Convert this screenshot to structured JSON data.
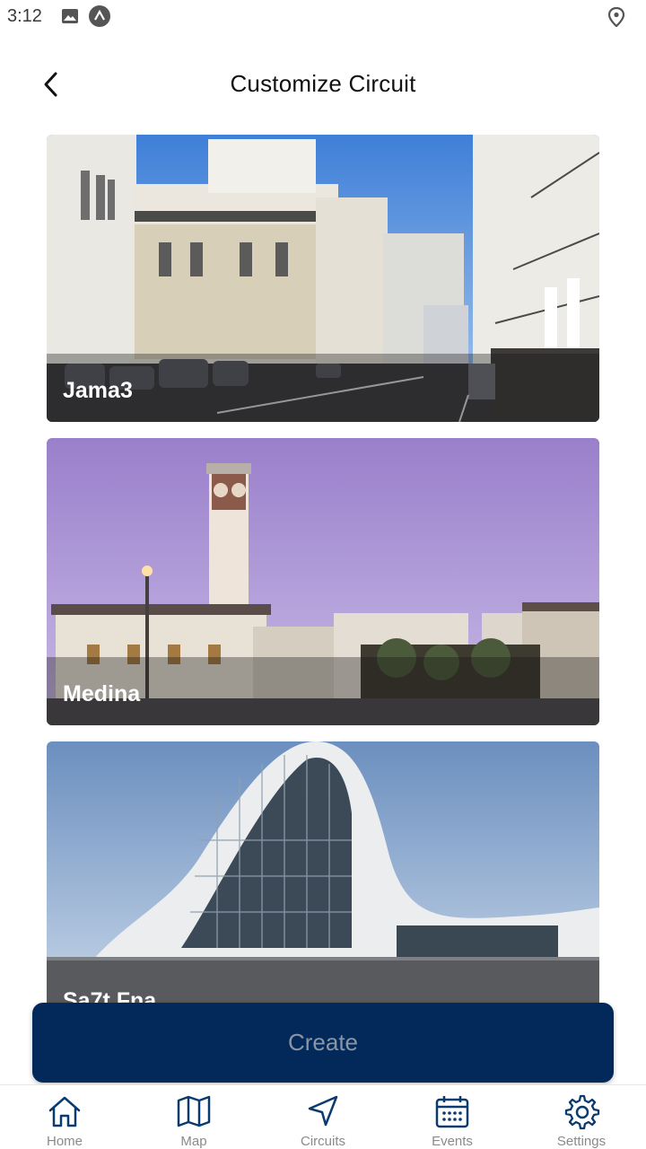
{
  "status_bar": {
    "time": "3:12",
    "icons": [
      "image-icon",
      "app-notification-icon",
      "location-icon"
    ]
  },
  "header": {
    "title": "Customize Circuit",
    "back_icon": "back-arrow-icon"
  },
  "circuits": [
    {
      "label": "Jama3"
    },
    {
      "label": "Medina"
    },
    {
      "label": "Sa7t Fna"
    }
  ],
  "create_button": {
    "label": "Create"
  },
  "bottom_nav": {
    "items": [
      {
        "label": "Home",
        "icon": "home-icon"
      },
      {
        "label": "Map",
        "icon": "map-icon"
      },
      {
        "label": "Circuits",
        "icon": "navigation-arrow-icon"
      },
      {
        "label": "Events",
        "icon": "calendar-icon"
      },
      {
        "label": "Settings",
        "icon": "gear-icon"
      }
    ]
  },
  "colors": {
    "primary": "#02295a",
    "nav_icon": "#0b3a6e",
    "nav_label": "#8a8a8a",
    "button_text": "#8a96a6"
  }
}
